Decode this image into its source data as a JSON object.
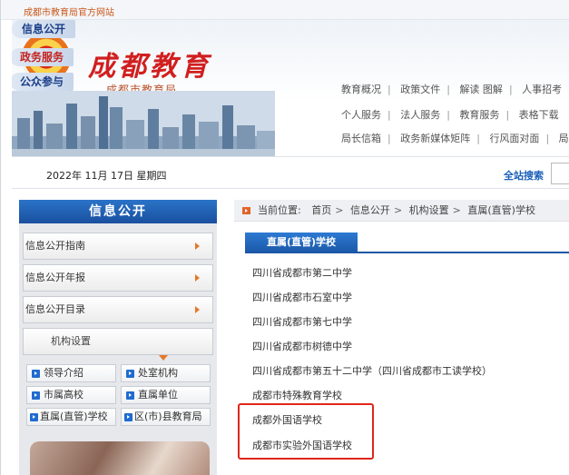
{
  "site_link": "成都市教育局官方网站",
  "brand": {
    "title": "成都教育",
    "subtitle": "成都市教育局"
  },
  "nav": {
    "tabs": [
      "信息公开",
      "政务服务",
      "公众参与"
    ],
    "lines": [
      [
        "教育概况",
        "政策文件",
        "解读 图解",
        "人事招考"
      ],
      [
        "个人服务",
        "法人服务",
        "教育服务",
        "表格下载"
      ],
      [
        "局长信箱",
        "政务新媒体矩阵",
        "行风面对面",
        "局"
      ]
    ]
  },
  "datebar": {
    "date": "2022年 11月 17日 星期四",
    "search_label": "全站搜索"
  },
  "sidebar": {
    "title": "信息公开",
    "items": [
      {
        "label": "信息公开指南"
      },
      {
        "label": "信息公开年报"
      },
      {
        "label": "信息公开目录"
      }
    ],
    "sub_item": "机构设置",
    "grid": [
      "领导介绍",
      "处室机构",
      "市属高校",
      "直属单位",
      "直属(直管)学校",
      "区(市)县教育局"
    ]
  },
  "breadcrumb": {
    "prefix": "当前位置:",
    "items": [
      "首页",
      "信息公开",
      "机构设置",
      "直属(直管)学校"
    ]
  },
  "section_title": "直属(直管)学校",
  "schools": [
    "四川省成都市第二中学",
    "四川省成都市石室中学",
    "四川省成都市第七中学",
    "四川省成都市树德中学",
    "四川省成都市第五十二中学（四川省成都市工读学校）",
    "成都市特殊教育学校",
    "成都外国语学校",
    "成都市实验外国语学校"
  ],
  "colors": {
    "brand_red": "#d11f1f",
    "nav_blue": "#1b58a8",
    "highlight": "#e0261c",
    "accent_orange": "#e4792a"
  }
}
